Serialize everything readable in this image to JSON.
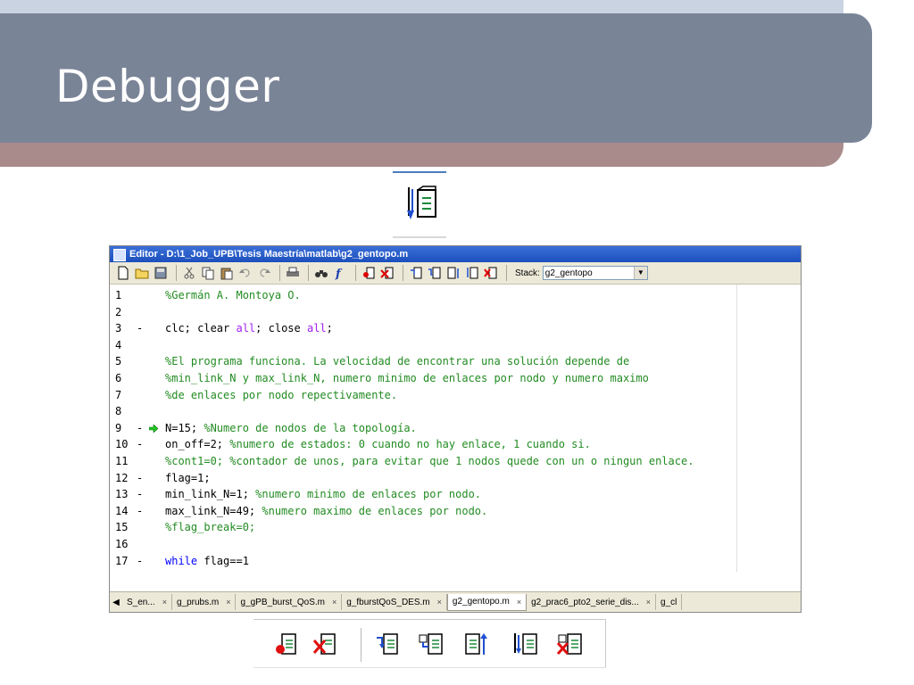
{
  "slide": {
    "title": "Debugger"
  },
  "hero_icon": {
    "name": "step-in-icon"
  },
  "editor": {
    "window_title": "Editor - D:\\1_Job_UPB\\Tesis Maestría\\matlab\\g2_gentopo.m",
    "toolbar": {
      "stack_label": "Stack:",
      "stack_value": "g2_gentopo"
    },
    "lines": [
      {
        "n": "1",
        "dash": "",
        "arrow": false,
        "parts": [
          {
            "t": "%Germán A. Montoya O.",
            "c": "cmt"
          }
        ]
      },
      {
        "n": "2",
        "dash": "",
        "arrow": false,
        "parts": []
      },
      {
        "n": "3",
        "dash": "-",
        "arrow": false,
        "parts": [
          {
            "t": "clc; clear ",
            "c": ""
          },
          {
            "t": "all",
            "c": "str"
          },
          {
            "t": "; close ",
            "c": ""
          },
          {
            "t": "all",
            "c": "str"
          },
          {
            "t": ";",
            "c": ""
          }
        ]
      },
      {
        "n": "4",
        "dash": "",
        "arrow": false,
        "parts": []
      },
      {
        "n": "5",
        "dash": "",
        "arrow": false,
        "parts": [
          {
            "t": "%El programa funciona. La velocidad de encontrar una solución depende de",
            "c": "cmt"
          }
        ]
      },
      {
        "n": "6",
        "dash": "",
        "arrow": false,
        "parts": [
          {
            "t": "%min_link_N y max_link_N, numero minimo de enlaces por nodo y numero maximo",
            "c": "cmt"
          }
        ]
      },
      {
        "n": "7",
        "dash": "",
        "arrow": false,
        "parts": [
          {
            "t": "%de enlaces por nodo repectivamente.",
            "c": "cmt"
          }
        ]
      },
      {
        "n": "8",
        "dash": "",
        "arrow": false,
        "parts": []
      },
      {
        "n": "9",
        "dash": "-",
        "arrow": true,
        "parts": [
          {
            "t": "N=15; ",
            "c": ""
          },
          {
            "t": "%Numero de nodos de la topología.",
            "c": "cmt"
          }
        ]
      },
      {
        "n": "10",
        "dash": "-",
        "arrow": false,
        "parts": [
          {
            "t": "on_off=2; ",
            "c": ""
          },
          {
            "t": "%numero de estados: 0 cuando no hay enlace, 1 cuando si.",
            "c": "cmt"
          }
        ]
      },
      {
        "n": "11",
        "dash": "",
        "arrow": false,
        "parts": [
          {
            "t": "%cont1=0; %contador de unos, para evitar que 1 nodos quede con un o ningun enlace.",
            "c": "cmt"
          }
        ]
      },
      {
        "n": "12",
        "dash": "-",
        "arrow": false,
        "parts": [
          {
            "t": "flag=1;",
            "c": ""
          }
        ]
      },
      {
        "n": "13",
        "dash": "-",
        "arrow": false,
        "parts": [
          {
            "t": "min_link_N=1; ",
            "c": ""
          },
          {
            "t": "%numero minimo de enlaces por nodo.",
            "c": "cmt"
          }
        ]
      },
      {
        "n": "14",
        "dash": "-",
        "arrow": false,
        "parts": [
          {
            "t": "max_link_N=49; ",
            "c": ""
          },
          {
            "t": "%numero maximo de enlaces por nodo.",
            "c": "cmt"
          }
        ]
      },
      {
        "n": "15",
        "dash": "",
        "arrow": false,
        "parts": [
          {
            "t": "%flag_break=0;",
            "c": "cmt"
          }
        ]
      },
      {
        "n": "16",
        "dash": "",
        "arrow": false,
        "parts": []
      },
      {
        "n": "17",
        "dash": "-",
        "arrow": false,
        "parts": [
          {
            "t": "while",
            "c": "kw"
          },
          {
            "t": " flag==1",
            "c": ""
          }
        ]
      }
    ],
    "tabs": [
      {
        "label": "S_en...",
        "active": false
      },
      {
        "label": "g_prubs.m",
        "active": false
      },
      {
        "label": "g_gPB_burst_QoS.m",
        "active": false
      },
      {
        "label": "g_fburstQoS_DES.m",
        "active": false
      },
      {
        "label": "g2_gentopo.m",
        "active": true
      },
      {
        "label": "g2_prac6_pto2_serie_dis...",
        "active": false
      },
      {
        "label": "g_cl",
        "active": false
      }
    ],
    "tab_close": "×"
  },
  "colors": {
    "title_bar": "#7a8497",
    "comment": "#228b22",
    "keyword": "#0000ff",
    "string": "#a020f0"
  }
}
